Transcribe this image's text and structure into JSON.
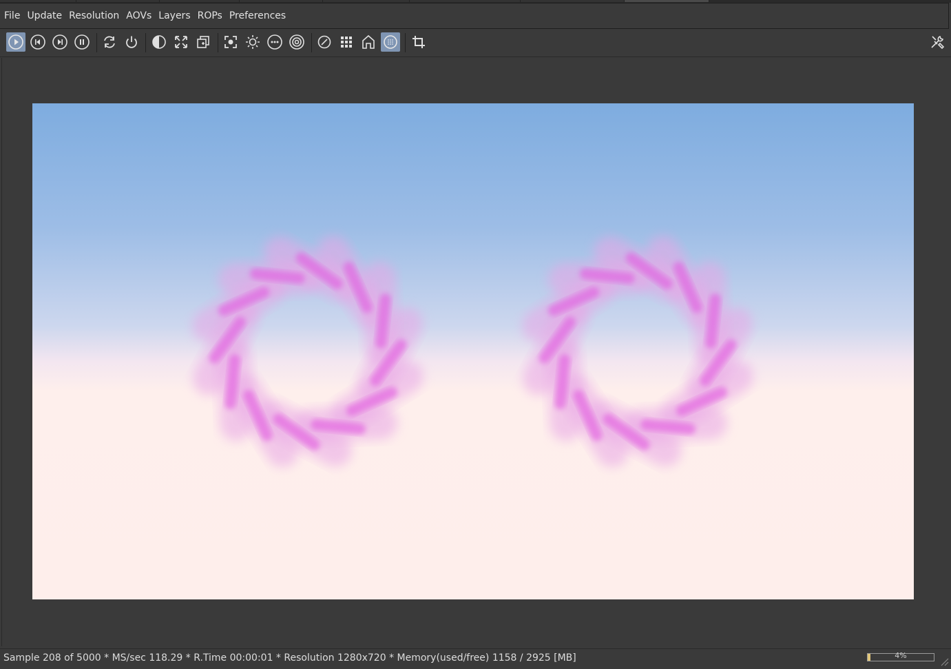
{
  "menu": {
    "items": [
      "File",
      "Update",
      "Resolution",
      "AOVs",
      "Layers",
      "ROPs",
      "Preferences"
    ]
  },
  "toolbar": {
    "buttons": [
      {
        "icon": "play-icon",
        "active": true
      },
      {
        "icon": "skip-back-icon"
      },
      {
        "icon": "skip-forward-icon"
      },
      {
        "icon": "pause-icon"
      },
      {
        "icon": "refresh-icon"
      },
      {
        "icon": "power-icon"
      },
      {
        "icon": "contrast-icon"
      },
      {
        "icon": "fit-view-icon"
      },
      {
        "icon": "region-icon"
      },
      {
        "icon": "focus-icon"
      },
      {
        "icon": "sun-icon"
      },
      {
        "icon": "more-icon"
      },
      {
        "icon": "target-icon"
      },
      {
        "icon": "exposure-icon"
      },
      {
        "icon": "grid-icon"
      },
      {
        "icon": "home-icon"
      },
      {
        "icon": "sphere-icon",
        "active": true
      },
      {
        "icon": "crop-icon"
      }
    ],
    "tools_icon": "tools-icon",
    "accent": "#7f95b3"
  },
  "status": {
    "text": "Sample 208 of 5000 * MS/sec 118.29 * R.Time 00:00:01 * Resolution 1280x720 * Memory(used/free) 1158 / 2925 [MB]",
    "progress_label": "4%",
    "progress_value": 0.04
  }
}
